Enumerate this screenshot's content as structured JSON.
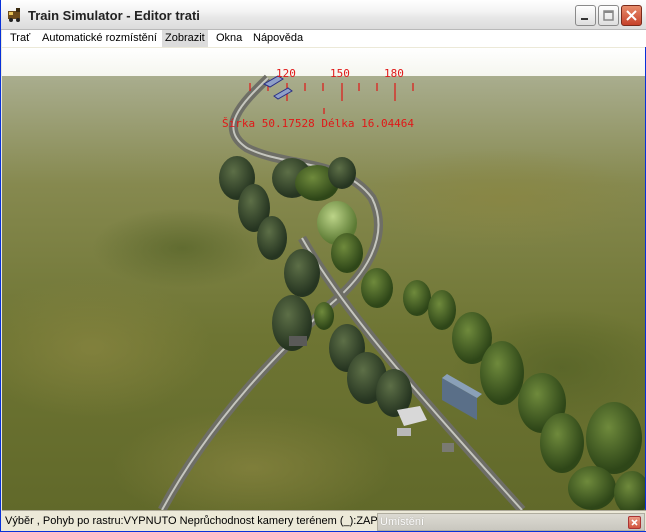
{
  "window": {
    "title": "Train Simulator - Editor trati",
    "app_icon": "train-icon",
    "controls": [
      "minimize-icon",
      "maximize-icon",
      "close-icon"
    ]
  },
  "menu": {
    "items": [
      "Trať",
      "Automatické rozmístění",
      "Zobrazit",
      "Okna",
      "Nápověda"
    ],
    "selected": "Zobrazit"
  },
  "hud": {
    "compass_labels": [
      "120",
      "150",
      "180"
    ],
    "coordinates": "Šírka 50.17528 Délka 16.04464",
    "color": "#e01818"
  },
  "statusbar": {
    "text": "Výběr , Pohyb po rastru:VYPNUTO Neprůchodnost kamery terénem (_):ZAPNUTO"
  },
  "panel": {
    "title": "Umístění",
    "close_icon": "close-icon"
  }
}
